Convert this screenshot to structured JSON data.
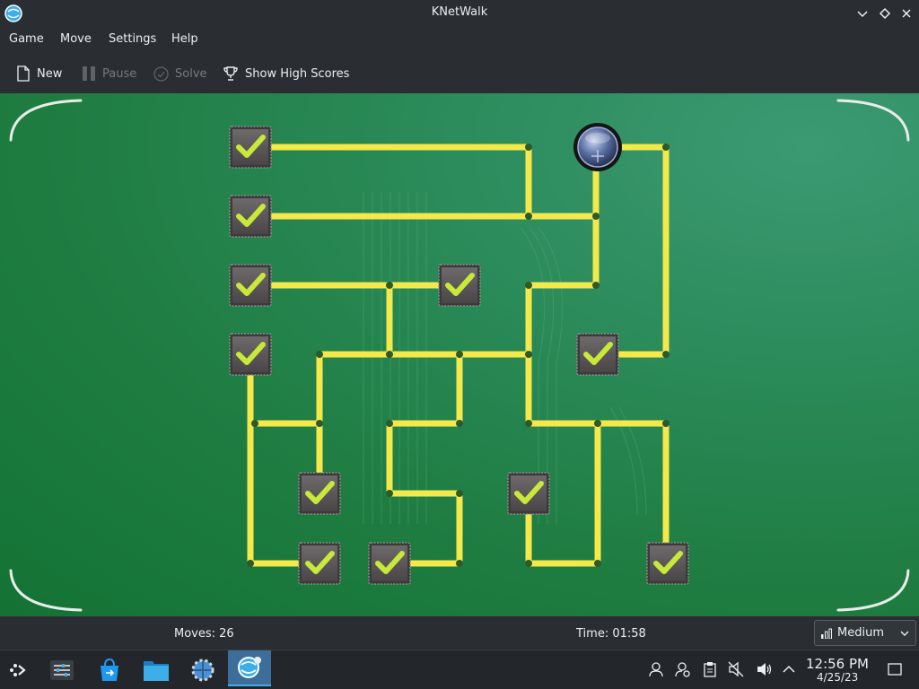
{
  "window": {
    "title": "KNetWalk",
    "app_icon": "knetwalk-app-icon",
    "buttons": [
      "minimize-icon",
      "maximize-icon",
      "close-icon"
    ]
  },
  "menu": {
    "game": "Game",
    "move": "Move",
    "settings": "Settings",
    "help": "Help"
  },
  "toolbar": {
    "new": "New",
    "pause": "Pause",
    "solve": "Solve",
    "high_scores": "Show High Scores"
  },
  "board": {
    "grid_size": "9x9 (visible 7x7 area)",
    "all_connected": true,
    "server_icon": "globe-server-icon",
    "terminal_icon": "checkmark-terminal-icon",
    "wire_color": "#f4e84a",
    "background_color": "#1f7d42"
  },
  "status": {
    "moves": "Moves: 26",
    "time": "Time: 01:58",
    "difficulty": "Medium"
  },
  "taskbar": {
    "time": "12:56 PM",
    "date": "4/25/23",
    "launchers": [
      "application-launcher-icon",
      "system-settings-icon",
      "discover-icon",
      "file-manager-icon",
      "system-info-icon",
      "knetwalk-task-icon"
    ],
    "tray": [
      "user-icon",
      "user-switch-icon",
      "clipboard-icon",
      "muted-speaker-icon",
      "volume-icon",
      "tray-expand-icon",
      "show-desktop-icon"
    ]
  },
  "colors": {
    "accent": "#3daee9",
    "panel": "#2a2e32",
    "wire": "#f4e84a",
    "check": "#c8e83a"
  }
}
